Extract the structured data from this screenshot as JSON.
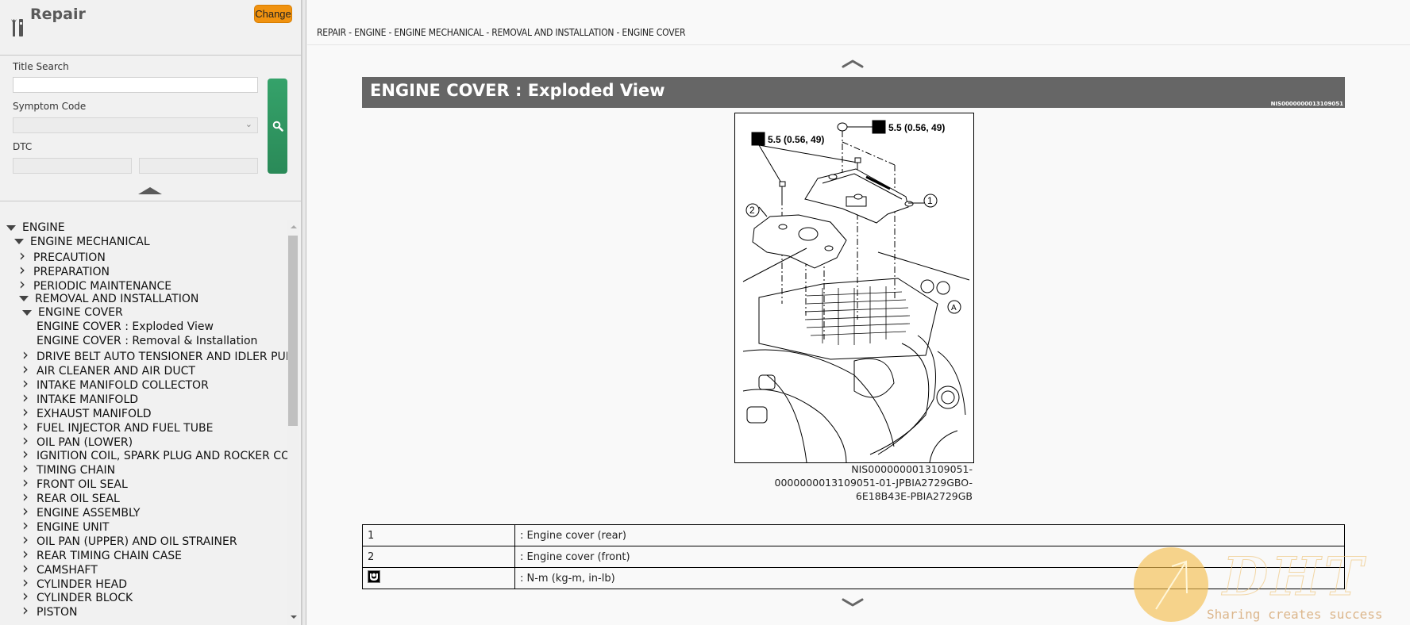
{
  "sidebar": {
    "title": "Repair",
    "change_label": "Change",
    "title_search_label": "Title Search",
    "title_search_value": "",
    "symptom_code_label": "Symptom Code",
    "symptom_code_value": "",
    "dtc_label": "DTC",
    "dtc_value_1": "",
    "dtc_value_2": "",
    "tree": [
      {
        "label": "ENGINE",
        "level": 0,
        "state": "expanded"
      },
      {
        "label": "ENGINE MECHANICAL",
        "level": 1,
        "state": "expanded"
      },
      {
        "label": "PRECAUTION",
        "level": 2,
        "state": "collapsed"
      },
      {
        "label": "PREPARATION",
        "level": 2,
        "state": "collapsed"
      },
      {
        "label": "PERIODIC MAINTENANCE",
        "level": 2,
        "state": "collapsed"
      },
      {
        "label": "REMOVAL AND INSTALLATION",
        "level": 2,
        "state": "expanded"
      },
      {
        "label": "ENGINE COVER",
        "level": 3,
        "state": "expanded"
      },
      {
        "label": "ENGINE COVER : Exploded View",
        "level": 4,
        "state": "leaf"
      },
      {
        "label": "ENGINE COVER : Removal & Installation",
        "level": 4,
        "state": "leaf"
      },
      {
        "label": "DRIVE BELT AUTO TENSIONER AND IDLER PULLEY",
        "level": 3,
        "state": "collapsed"
      },
      {
        "label": "AIR CLEANER AND AIR DUCT",
        "level": 3,
        "state": "collapsed"
      },
      {
        "label": "INTAKE MANIFOLD COLLECTOR",
        "level": 3,
        "state": "collapsed"
      },
      {
        "label": "INTAKE MANIFOLD",
        "level": 3,
        "state": "collapsed"
      },
      {
        "label": "EXHAUST MANIFOLD",
        "level": 3,
        "state": "collapsed"
      },
      {
        "label": "FUEL INJECTOR AND FUEL TUBE",
        "level": 3,
        "state": "collapsed"
      },
      {
        "label": "OIL PAN (LOWER)",
        "level": 3,
        "state": "collapsed"
      },
      {
        "label": "IGNITION COIL, SPARK PLUG AND ROCKER COVER",
        "level": 3,
        "state": "collapsed"
      },
      {
        "label": "TIMING CHAIN",
        "level": 3,
        "state": "collapsed"
      },
      {
        "label": "FRONT OIL SEAL",
        "level": 3,
        "state": "collapsed"
      },
      {
        "label": "REAR OIL SEAL",
        "level": 3,
        "state": "collapsed"
      },
      {
        "label": "ENGINE ASSEMBLY",
        "level": 3,
        "state": "collapsed"
      },
      {
        "label": "ENGINE UNIT",
        "level": 3,
        "state": "collapsed"
      },
      {
        "label": "OIL PAN (UPPER) AND OIL STRAINER",
        "level": 3,
        "state": "collapsed"
      },
      {
        "label": "REAR TIMING CHAIN CASE",
        "level": 3,
        "state": "collapsed"
      },
      {
        "label": "CAMSHAFT",
        "level": 3,
        "state": "collapsed"
      },
      {
        "label": "CYLINDER HEAD",
        "level": 3,
        "state": "collapsed"
      },
      {
        "label": "CYLINDER BLOCK",
        "level": 3,
        "state": "collapsed"
      },
      {
        "label": "PISTON",
        "level": 3,
        "state": "collapsed"
      }
    ]
  },
  "main": {
    "breadcrumb": "REPAIR - ENGINE - ENGINE MECHANICAL - REMOVAL AND INSTALLATION - ENGINE COVER",
    "title": "ENGINE COVER : Exploded View",
    "doc_id": "NIS0000000013109051",
    "figure": {
      "torque_callout_1": "5.5 (0.56, 49)",
      "torque_callout_2": "5.5 (0.56, 49)",
      "part_1": "1",
      "part_2": "2",
      "inset_label": "A"
    },
    "figure_caption": [
      "NIS0000000013109051-",
      "0000000013109051-01-JPBIA2729GBO-",
      "6E18B43E-PBIA2729GB"
    ],
    "legend": [
      {
        "key": "1",
        "desc": ": Engine cover (rear)"
      },
      {
        "key": "2",
        "desc": ": Engine cover (front)"
      },
      {
        "key": "",
        "icon": "torque-wrench-icon",
        "desc": ": N-m (kg-m, in-lb)"
      }
    ]
  },
  "watermark": {
    "brand": "DHT",
    "tagline": "Sharing creates success"
  },
  "colors": {
    "change_button": "#f0920f",
    "search_button": "#2e9460",
    "title_bar": "#666666",
    "sidebar_bg": "#f1f1f1"
  }
}
